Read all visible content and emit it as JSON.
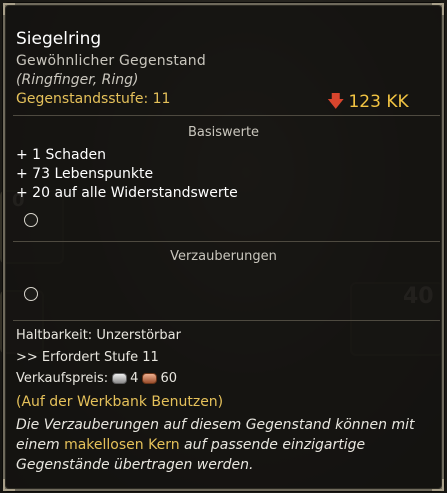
{
  "item": {
    "name": "Siegelring",
    "rarity": "Gewöhnlicher Gegenstand",
    "slot": "(Ringfinger, Ring)",
    "level_label": "Gegenstandsstufe:",
    "level_value": "11",
    "power_value": "123 KK",
    "power_trend": "down"
  },
  "sections": {
    "base_title": "Basiswerte",
    "enchant_title": "Verzauberungen"
  },
  "stats": [
    "+ 1 Schaden",
    "+ 73 Lebenspunkte",
    "+ 20 auf alle Widerstandswerte"
  ],
  "info": {
    "durability_label": "Haltbarkeit:",
    "durability_value": "Unzerstörbar",
    "requirement": ">> Erfordert Stufe 11",
    "sell_label": "Verkaufspreis:",
    "sell_silver": "4",
    "sell_copper": "60",
    "workbench": "(Auf der Werkbank Benutzen)"
  },
  "description": {
    "part1": "Die Verzauberungen auf diesem Gegenstand können mit einem",
    "highlight": "makellosen Kern",
    "part2": "auf passende einzigartige Gegenstände übertragen werden."
  },
  "background": {
    "number_a": "40",
    "number_b": "0"
  },
  "colors": {
    "title_white": "#ffffff",
    "gold": "#e5c15a",
    "power_gold": "#f2c442",
    "down_arrow": "#d8452d"
  },
  "icons": {
    "power": "arrow-down-icon",
    "silver": "silver-coins-icon",
    "copper": "copper-coins-icon"
  }
}
